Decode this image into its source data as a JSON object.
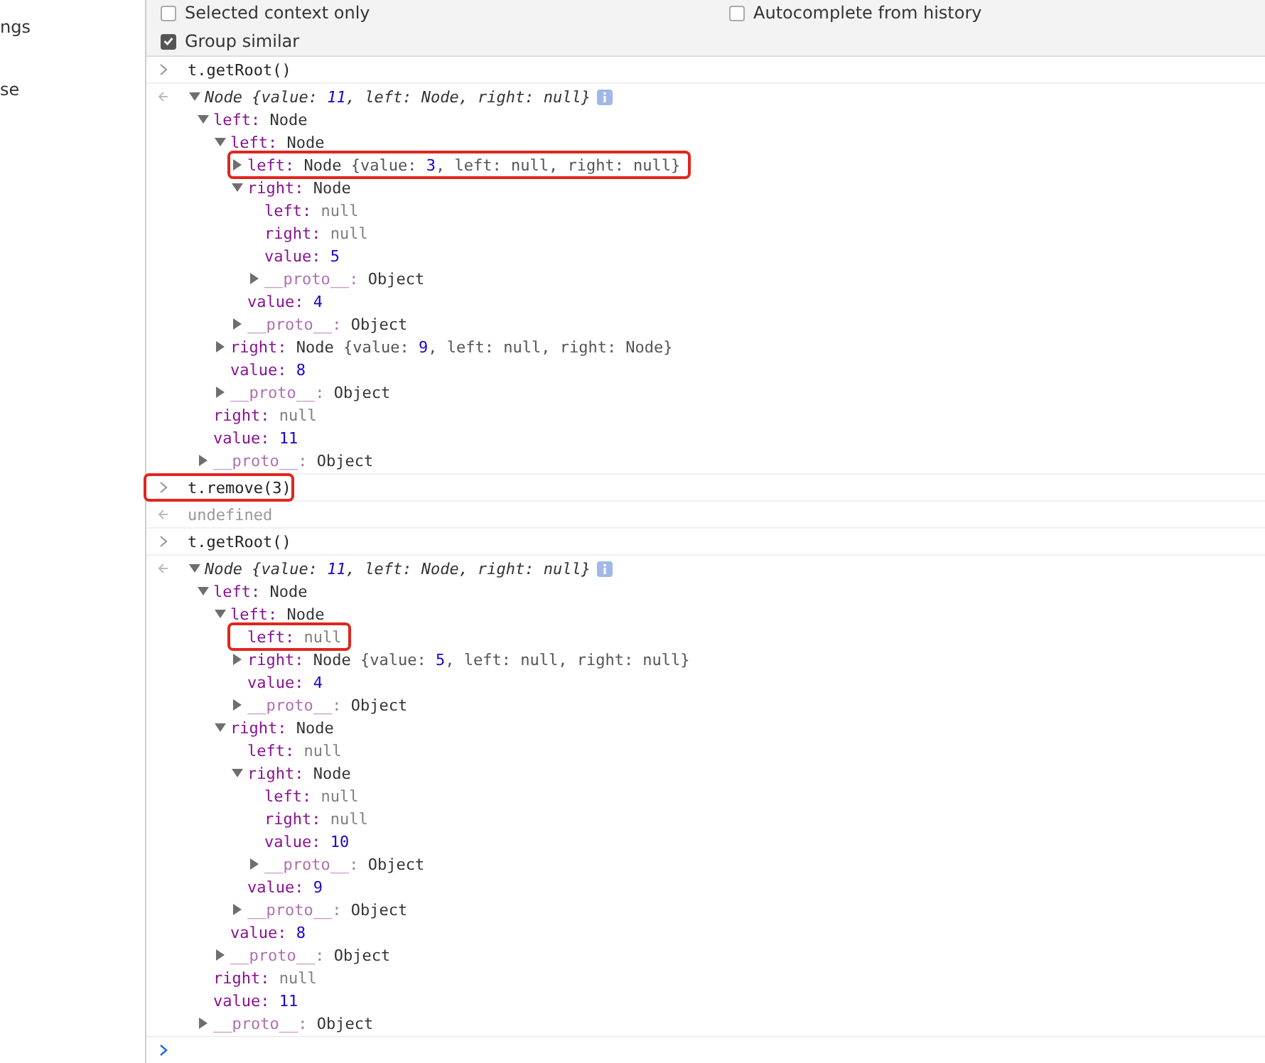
{
  "sidebar": {
    "items": [
      {
        "label": "ngs"
      },
      {
        "label": "se"
      }
    ]
  },
  "settings": [
    {
      "label": "Selected context only",
      "checked": false
    },
    {
      "label": "Autocomplete from history",
      "checked": false
    },
    {
      "label": "Group similar",
      "checked": true
    }
  ],
  "console": [
    {
      "kind": "input",
      "text": "t.getRoot()"
    },
    {
      "kind": "tree",
      "root": {
        "preview": "Node {value: 11, left: Node, right: null}",
        "expanded": true,
        "children": [
          {
            "key": "left:",
            "kind": "object",
            "value": "Node",
            "expanded": true,
            "children": [
              {
                "key": "left:",
                "kind": "object",
                "value": "Node",
                "expanded": true,
                "children": [
                  {
                    "key": "left:",
                    "kind": "object",
                    "value": "Node",
                    "preview": "{value: 3, left: null, right: null}",
                    "expanded": false,
                    "highlighted": true
                  },
                  {
                    "key": "right:",
                    "kind": "object",
                    "value": "Node",
                    "expanded": true,
                    "children": [
                      {
                        "key": "left:",
                        "kind": "null",
                        "value": "null"
                      },
                      {
                        "key": "right:",
                        "kind": "null",
                        "value": "null"
                      },
                      {
                        "key": "value:",
                        "kind": "number",
                        "value": "5"
                      },
                      {
                        "key": "__proto__:",
                        "kind": "proto",
                        "value": "Object",
                        "expanded": false
                      }
                    ]
                  },
                  {
                    "key": "value:",
                    "kind": "number",
                    "value": "4"
                  },
                  {
                    "key": "__proto__:",
                    "kind": "proto",
                    "value": "Object",
                    "expanded": false
                  }
                ]
              },
              {
                "key": "right:",
                "kind": "object",
                "value": "Node",
                "preview": "{value: 9, left: null, right: Node}",
                "expanded": false
              },
              {
                "key": "value:",
                "kind": "number",
                "value": "8"
              },
              {
                "key": "__proto__:",
                "kind": "proto",
                "value": "Object",
                "expanded": false
              }
            ]
          },
          {
            "key": "right:",
            "kind": "null",
            "value": "null"
          },
          {
            "key": "value:",
            "kind": "number",
            "value": "11"
          },
          {
            "key": "__proto__:",
            "kind": "proto",
            "value": "Object",
            "expanded": false
          }
        ]
      }
    },
    {
      "kind": "input",
      "text": "t.remove(3)",
      "highlighted": true
    },
    {
      "kind": "result",
      "text": "undefined"
    },
    {
      "kind": "input",
      "text": "t.getRoot()"
    },
    {
      "kind": "tree",
      "root": {
        "preview": "Node {value: 11, left: Node, right: null}",
        "expanded": true,
        "children": [
          {
            "key": "left:",
            "kind": "object",
            "value": "Node",
            "expanded": true,
            "children": [
              {
                "key": "left:",
                "kind": "object",
                "value": "Node",
                "expanded": true,
                "children": [
                  {
                    "key": "left:",
                    "kind": "null",
                    "value": "null",
                    "highlighted": true
                  },
                  {
                    "key": "right:",
                    "kind": "object",
                    "value": "Node",
                    "preview": "{value: 5, left: null, right: null}",
                    "expanded": false
                  },
                  {
                    "key": "value:",
                    "kind": "number",
                    "value": "4"
                  },
                  {
                    "key": "__proto__:",
                    "kind": "proto",
                    "value": "Object",
                    "expanded": false
                  }
                ]
              },
              {
                "key": "right:",
                "kind": "object",
                "value": "Node",
                "expanded": true,
                "children": [
                  {
                    "key": "left:",
                    "kind": "null",
                    "value": "null"
                  },
                  {
                    "key": "right:",
                    "kind": "object",
                    "value": "Node",
                    "expanded": true,
                    "children": [
                      {
                        "key": "left:",
                        "kind": "null",
                        "value": "null"
                      },
                      {
                        "key": "right:",
                        "kind": "null",
                        "value": "null"
                      },
                      {
                        "key": "value:",
                        "kind": "number",
                        "value": "10"
                      },
                      {
                        "key": "__proto__:",
                        "kind": "proto",
                        "value": "Object",
                        "expanded": false
                      }
                    ]
                  },
                  {
                    "key": "value:",
                    "kind": "number",
                    "value": "9"
                  },
                  {
                    "key": "__proto__:",
                    "kind": "proto",
                    "value": "Object",
                    "expanded": false
                  }
                ]
              },
              {
                "key": "value:",
                "kind": "number",
                "value": "8"
              },
              {
                "key": "__proto__:",
                "kind": "proto",
                "value": "Object",
                "expanded": false
              }
            ]
          },
          {
            "key": "right:",
            "kind": "null",
            "value": "null"
          },
          {
            "key": "value:",
            "kind": "number",
            "value": "11"
          },
          {
            "key": "__proto__:",
            "kind": "proto",
            "value": "Object",
            "expanded": false
          }
        ]
      }
    },
    {
      "kind": "prompt"
    }
  ]
}
